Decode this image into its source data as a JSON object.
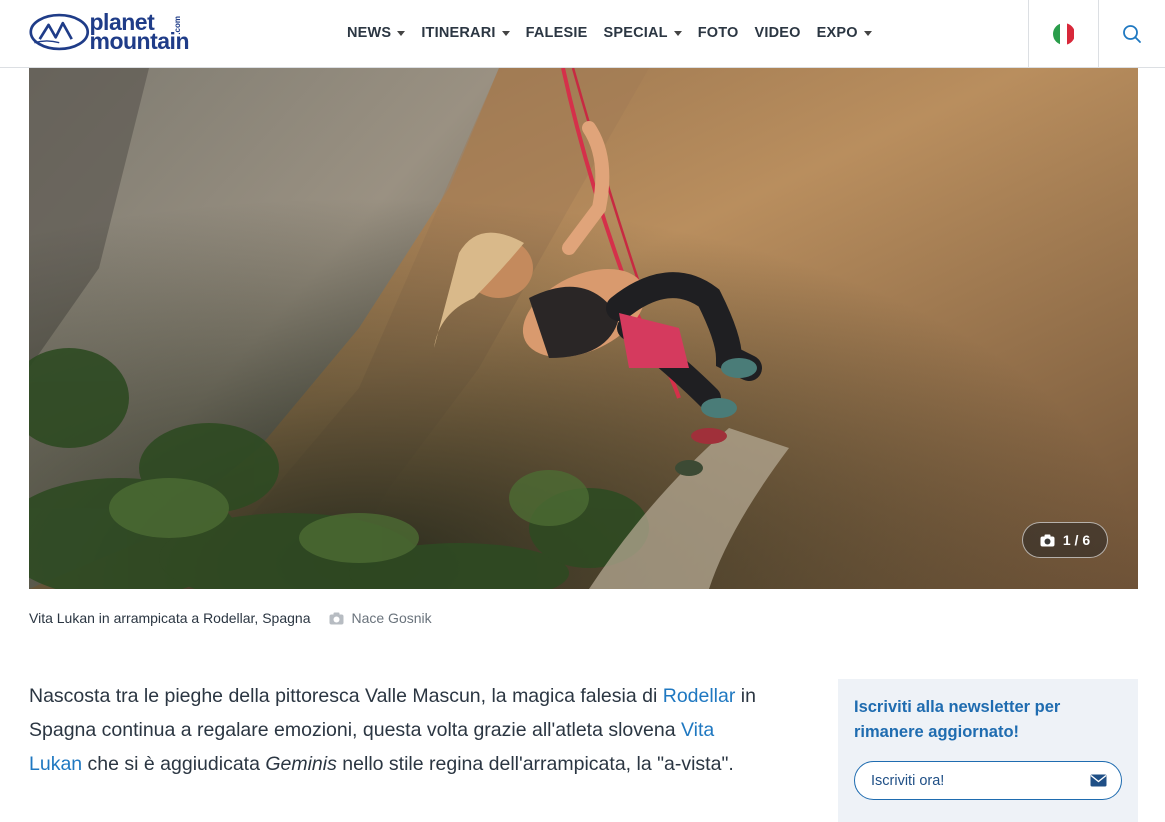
{
  "brand": {
    "logo_line1": "planet",
    "logo_line2": "mountain",
    "logo_suffix": ".com"
  },
  "nav": {
    "items": [
      {
        "label": "NEWS",
        "dropdown": true
      },
      {
        "label": "ITINERARI",
        "dropdown": true
      },
      {
        "label": "FALESIE",
        "dropdown": false
      },
      {
        "label": "SPECIAL",
        "dropdown": true
      },
      {
        "label": "FOTO",
        "dropdown": false
      },
      {
        "label": "VIDEO",
        "dropdown": false
      },
      {
        "label": "EXPO",
        "dropdown": true
      }
    ],
    "language_flag": "italy-flag-icon",
    "search_icon": "search-icon"
  },
  "gallery": {
    "counter": "1 / 6",
    "caption": "Vita Lukan in arrampicata a Rodellar, Spagna",
    "credit": "Nace Gosnik"
  },
  "article": {
    "p1_a": "Nascosta tra le pieghe della pittoresca Valle Mascun, la magica falesia di ",
    "p1_link1": "Rodellar",
    "p1_b": " in Spagna continua a regalare emozioni, questa volta grazie all'atleta slovena ",
    "p1_link2": "Vita Lukan",
    "p1_c": " che si è aggiudicata ",
    "p1_em": "Geminis",
    "p1_d": " nello stile regina dell'arrampicata, la \"a-vista\"."
  },
  "newsletter": {
    "title": "Iscriviti alla newsletter per rimanere aggiornato!",
    "button_label": "Iscriviti ora!",
    "button_icon": "envelope-icon"
  },
  "colors": {
    "brand_blue": "#1f3c88",
    "link_blue": "#1f78c1",
    "newsletter_bg": "#eef2f7"
  }
}
